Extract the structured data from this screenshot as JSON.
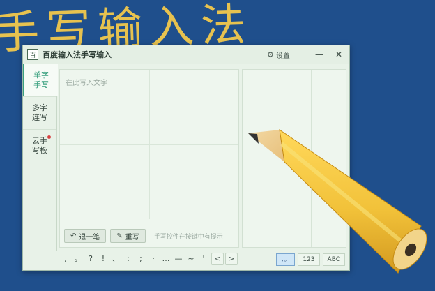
{
  "backdrop": {
    "title": "手写输入法"
  },
  "window": {
    "title": "百度输入法手写输入",
    "settings_label": "设置",
    "minimize_glyph": "—",
    "close_glyph": "✕",
    "app_icon_glyph": "百"
  },
  "sidebar": {
    "items": [
      {
        "label": "单字手写",
        "active": true
      },
      {
        "label": "多字连写",
        "active": false
      },
      {
        "label": "云手写板",
        "active": false,
        "badge": "red-dot"
      }
    ]
  },
  "write_area": {
    "placeholder": "在此写入文字",
    "buttons": [
      {
        "label": "退一笔",
        "icon": "undo-stroke-icon"
      },
      {
        "label": "重写",
        "icon": "eraser-icon"
      }
    ],
    "hint": "手写控件在按键中有提示"
  },
  "bottom": {
    "punctuation": [
      ",",
      "。",
      "?",
      "!",
      "、",
      ":",
      ";",
      "·",
      "…",
      "—",
      "~",
      "'"
    ],
    "nav": [
      "<",
      ">"
    ],
    "modes": [
      {
        "label": "，。",
        "active": true
      },
      {
        "label": "123",
        "active": false
      },
      {
        "label": "ABC",
        "active": false
      }
    ]
  },
  "colors": {
    "accent": "#3aa07f",
    "background": "#1f4f8c",
    "window_bg": "#e8f2e8",
    "pencil_yellow": "#f2c23a"
  }
}
